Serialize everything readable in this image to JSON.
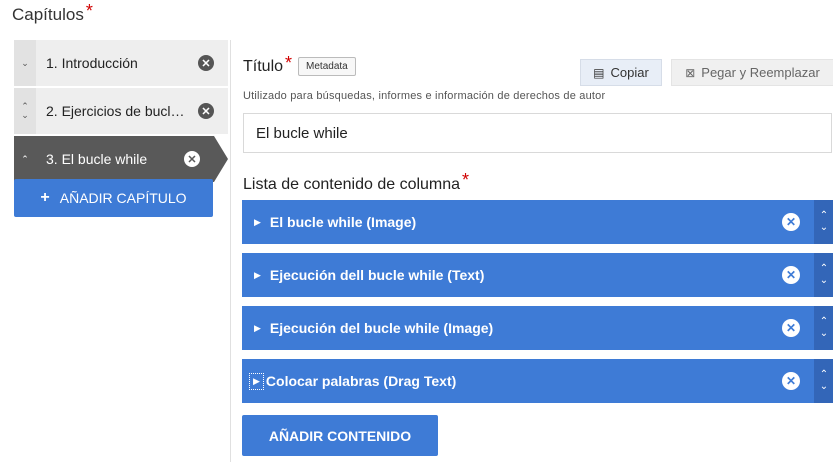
{
  "chapters": {
    "title": "Capítulos",
    "required_mark": "*",
    "items": [
      {
        "label": "1. Introducción",
        "arrows": [
          "⌄"
        ]
      },
      {
        "label": "2. Ejercicios de bucl…",
        "arrows": [
          "⌃",
          "⌄"
        ]
      },
      {
        "label": "3. El bucle while",
        "arrows": [
          "⌃"
        ],
        "active": true
      }
    ],
    "remove_glyph": "✕",
    "add_label": "AÑADIR CAPÍTULO",
    "add_icon": "+"
  },
  "title_field": {
    "label": "Título",
    "required_mark": "*",
    "metadata_label": "Metadata",
    "copy_label": "Copiar",
    "paste_label": "Pegar y Reemplazar",
    "copy_icon": "clipboard-icon",
    "paste_icon": "paste-icon",
    "description": "Utilizado para búsquedas, informes e información de derechos de autor",
    "value": "El bucle while"
  },
  "content_list": {
    "label": "Lista de contenido de columna",
    "required_mark": "*",
    "items": [
      {
        "name": "El bucle while (Image)"
      },
      {
        "name": "Ejecución dell bucle while (Text)"
      },
      {
        "name": "Ejecución del bucle while (Image)"
      },
      {
        "name": "Colocar palabras (Drag Text)"
      }
    ],
    "expand_glyph": "▶",
    "remove_glyph": "✕",
    "up_glyph": "⌃",
    "down_glyph": "⌄",
    "add_label": "AÑADIR CONTENIDO"
  },
  "colors": {
    "accent": "#3e7bd6",
    "active_chapter": "#595959",
    "required": "#d00000"
  }
}
